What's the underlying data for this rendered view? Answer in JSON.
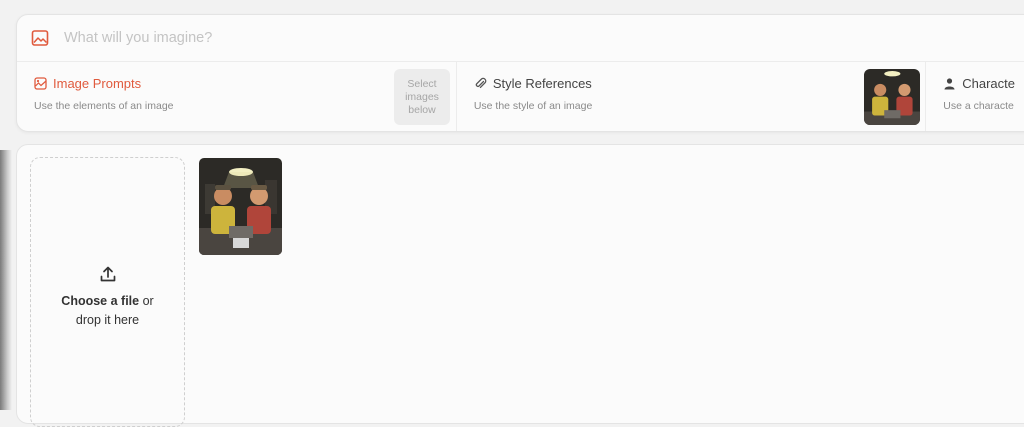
{
  "prompt": {
    "placeholder": "What will you imagine?"
  },
  "references": {
    "image_prompts": {
      "title": "Image Prompts",
      "description": "Use the elements of an image",
      "select_label": [
        "Select",
        "images",
        "below"
      ]
    },
    "style_references": {
      "title": "Style References",
      "description": "Use the style of an image"
    },
    "character": {
      "title": "Characte",
      "description": "Use a characte"
    }
  },
  "upload": {
    "line1_bold": "Choose a file",
    "line1_rest": " or",
    "line2": "drop it here"
  },
  "colors": {
    "accent": "#e05a3d",
    "muted_text": "#8a8a8a",
    "placeholder": "#c4c4c4"
  },
  "icons": {
    "prompt": "image-icon",
    "image_prompts": "image-prompt-icon",
    "style_references": "paperclip-icon",
    "character": "person-icon",
    "upload": "upload-icon"
  }
}
